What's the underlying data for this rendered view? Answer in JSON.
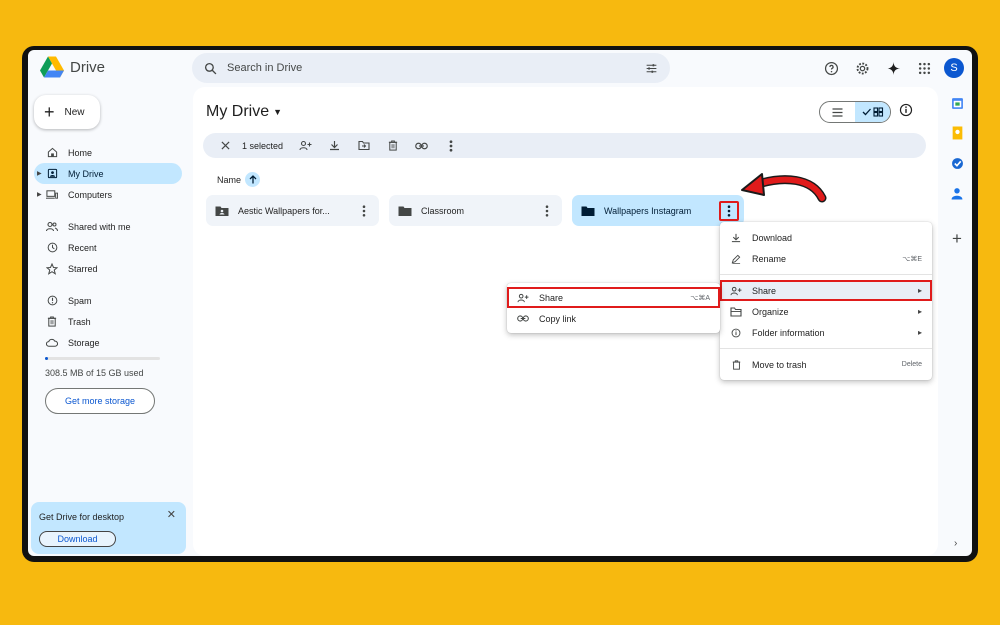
{
  "app": {
    "name": "Drive"
  },
  "search": {
    "placeholder": "Search in Drive"
  },
  "header_icons": [
    "help-icon",
    "settings-icon",
    "gemini-icon",
    "apps-grid-icon"
  ],
  "user": {
    "avatar_letter": "S"
  },
  "sidebar": {
    "new_label": "New",
    "items": [
      {
        "label": "Home",
        "icon": "home-icon"
      },
      {
        "label": "My Drive",
        "icon": "my-drive-icon",
        "active": true
      },
      {
        "label": "Computers",
        "icon": "computers-icon"
      },
      {
        "label": "Shared with me",
        "icon": "shared-icon"
      },
      {
        "label": "Recent",
        "icon": "clock-icon"
      },
      {
        "label": "Starred",
        "icon": "star-icon"
      },
      {
        "label": "Spam",
        "icon": "spam-icon"
      },
      {
        "label": "Trash",
        "icon": "trash-icon"
      },
      {
        "label": "Storage",
        "icon": "cloud-icon"
      }
    ],
    "storage_used_fraction": 0.02,
    "storage_text": "308.5 MB of 15 GB used",
    "get_storage_label": "Get more storage"
  },
  "promo": {
    "title": "Get Drive for desktop",
    "button": "Download"
  },
  "main": {
    "title": "My Drive",
    "selection_text": "1 selected",
    "sort_label": "Name",
    "folders": [
      {
        "name": "Aestic Wallpapers for...",
        "shared": true
      },
      {
        "name": "Classroom"
      },
      {
        "name": "Wallpapers Instagram",
        "selected": true
      }
    ]
  },
  "context_menu": {
    "items": [
      {
        "label": "Download",
        "icon": "download-icon"
      },
      {
        "label": "Rename",
        "icon": "rename-icon",
        "shortcut": "⌥⌘E"
      },
      {
        "label": "Share",
        "icon": "share-icon",
        "submenu": true
      },
      {
        "label": "Organize",
        "icon": "organize-icon",
        "submenu": true
      },
      {
        "label": "Folder information",
        "icon": "info-icon",
        "submenu": true
      },
      {
        "label": "Move to trash",
        "icon": "trash-icon",
        "shortcut": "Delete"
      }
    ]
  },
  "share_submenu": {
    "items": [
      {
        "label": "Share",
        "icon": "share-icon",
        "shortcut": "⌥⌘A"
      },
      {
        "label": "Copy link",
        "icon": "link-icon"
      }
    ]
  },
  "colors": {
    "background": "#F7B90F",
    "accent": "#0B57D0",
    "selected": "#C2E7FF",
    "highlight": "#E01B1B"
  }
}
